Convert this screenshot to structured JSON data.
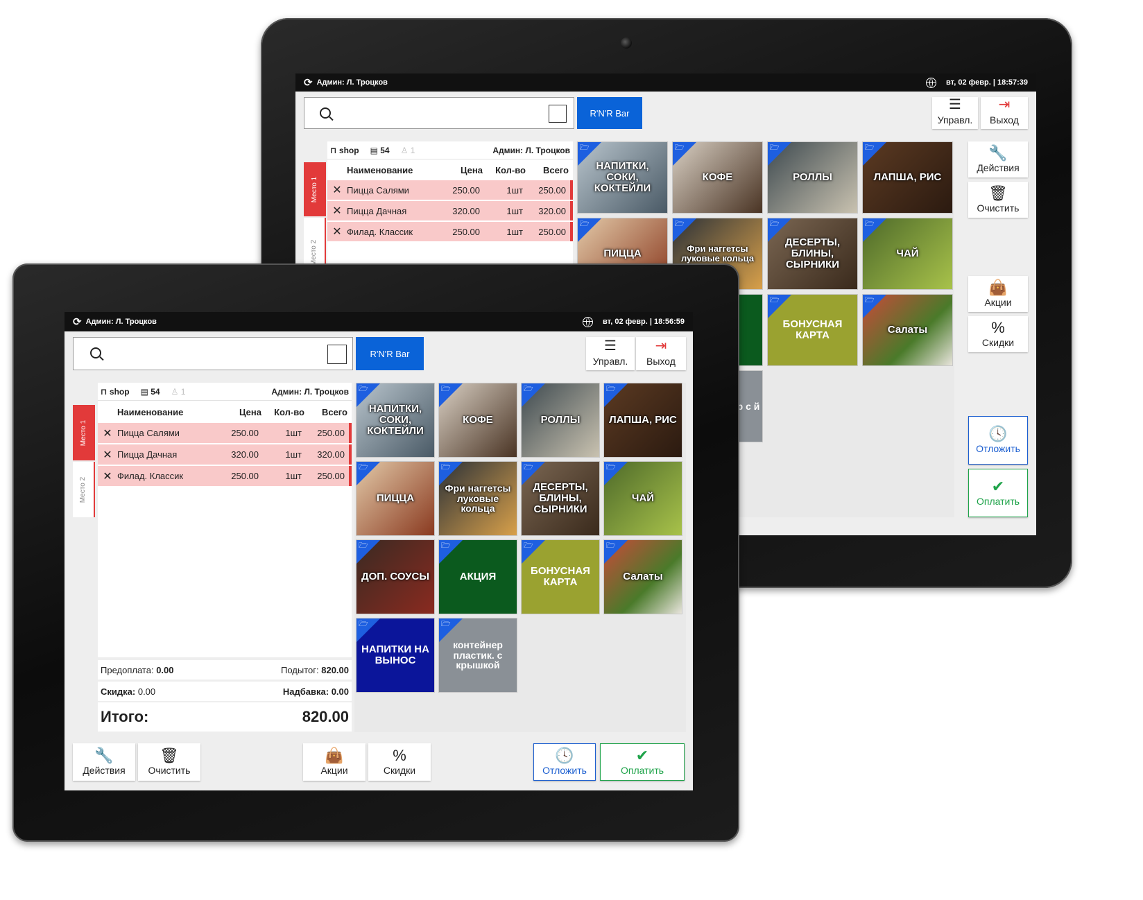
{
  "colors": {
    "accent_blue": "#0a63d8",
    "seat_red": "#e23a3a",
    "row_pink": "#f9c9c9",
    "pay_green": "#1fa34a"
  },
  "back": {
    "status": {
      "user": "Админ: Л. Троцков",
      "datetime": "вт, 02 февр.  | 18:57:39"
    },
    "venue": "R'N'R Bar",
    "menu": {
      "label": "Управл.",
      "icon": "hamburger-icon"
    },
    "exit": {
      "label": "Выход",
      "icon": "exit-icon"
    },
    "order_info": {
      "table": "shop",
      "check_no": "54",
      "guests": "1",
      "waiter": "Админ: Л. Троцков"
    },
    "columns": [
      "Наименование",
      "Цена",
      "Кол-во",
      "Всего"
    ],
    "seats": [
      "Место 1",
      "Место 2"
    ],
    "items": [
      {
        "name": "Пицца Салями",
        "price": "250.00",
        "qty": "1шт",
        "total": "250.00"
      },
      {
        "name": "Пицца Дачная",
        "price": "320.00",
        "qty": "1шт",
        "total": "320.00"
      },
      {
        "name": "Филад. Классик",
        "price": "250.00",
        "qty": "1шт",
        "total": "250.00"
      }
    ],
    "tiles": [
      "НАПИТКИ, СОКИ, КОКТЕЙЛИ",
      "КОФЕ",
      "РОЛЛЫ",
      "ЛАПША, РИС",
      "ПИЦЦА",
      "Фри наггетсы луковые кольца",
      "ДЕСЕРТЫ, БЛИНЫ, СЫРНИКИ",
      "ЧАЙ",
      "",
      "БОНУСНАЯ КАРТА",
      "Салаты",
      "р с й"
    ],
    "side_buttons": [
      {
        "label": "Действия",
        "icon": "wrench-icon"
      },
      {
        "label": "Очистить",
        "icon": "trash-icon"
      },
      {
        "label": "Акции",
        "icon": "bag-icon"
      },
      {
        "label": "Скидки",
        "icon": "percent-icon"
      },
      {
        "label": "Отложить",
        "icon": "clock-icon"
      },
      {
        "label": "Оплатить",
        "icon": "check-icon"
      }
    ]
  },
  "front": {
    "status": {
      "user": "Админ: Л. Троцков",
      "datetime": "вт, 02 февр.  | 18:56:59"
    },
    "venue": "R'N'R Bar",
    "menu": {
      "label": "Управл.",
      "icon": "hamburger-icon"
    },
    "exit": {
      "label": "Выход",
      "icon": "exit-icon"
    },
    "order_info": {
      "table": "shop",
      "check_no": "54",
      "guests": "1",
      "waiter": "Админ: Л. Троцков"
    },
    "columns": [
      "Наименование",
      "Цена",
      "Кол-во",
      "Всего"
    ],
    "seats": [
      "Место 1",
      "Место 2"
    ],
    "items": [
      {
        "name": "Пицца Салями",
        "price": "250.00",
        "qty": "1шт",
        "total": "250.00"
      },
      {
        "name": "Пицца Дачная",
        "price": "320.00",
        "qty": "1шт",
        "total": "320.00"
      },
      {
        "name": "Филад. Классик",
        "price": "250.00",
        "qty": "1шт",
        "total": "250.00"
      }
    ],
    "summary": {
      "prepay_label": "Предоплата:",
      "prepay_value": "0.00",
      "subtotal_label": "Подытог:",
      "subtotal_value": "820.00",
      "discount_label": "Скидка:",
      "discount_value": "0.00",
      "surcharge_label": "Надбавка:",
      "surcharge_value": "0.00",
      "total_label": "Итого:",
      "total_value": "820.00"
    },
    "tiles": [
      "НАПИТКИ, СОКИ, КОКТЕЙЛИ",
      "КОФЕ",
      "РОЛЛЫ",
      "ЛАПША, РИС",
      "ПИЦЦА",
      "Фри наггетсы луковые кольца",
      "ДЕСЕРТЫ, БЛИНЫ, СЫРНИКИ",
      "ЧАЙ",
      "ДОП. СОУСЫ",
      "АКЦИЯ",
      "БОНУСНАЯ КАРТА",
      "Салаты",
      "НАПИТКИ НА ВЫНОС",
      "контейнер пластик. с крышкой"
    ],
    "bottom_buttons": [
      {
        "label": "Действия",
        "icon": "wrench-icon"
      },
      {
        "label": "Очистить",
        "icon": "trash-icon"
      },
      {
        "label": "Акции",
        "icon": "bag-icon"
      },
      {
        "label": "Скидки",
        "icon": "percent-icon"
      },
      {
        "label": "Отложить",
        "icon": "clock-icon"
      },
      {
        "label": "Оплатить",
        "icon": "check-icon"
      }
    ]
  }
}
